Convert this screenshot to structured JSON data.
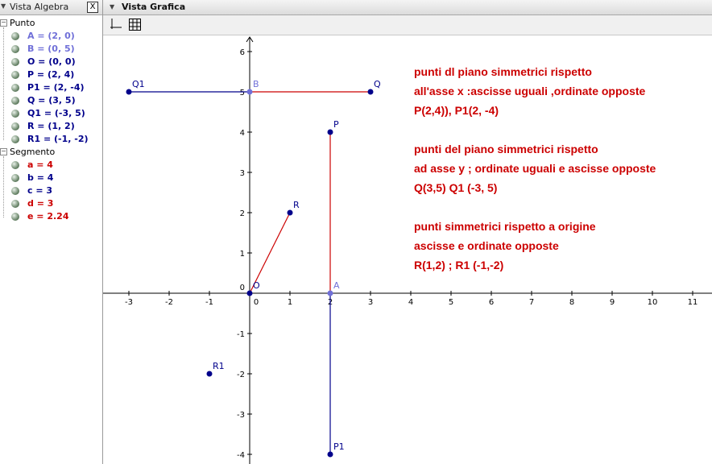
{
  "algebra": {
    "title": "Vista Algebra",
    "close_label": "X",
    "groups": [
      {
        "label": "Punto",
        "items": [
          {
            "text": "A = (2, 0)",
            "color": "#7070d8"
          },
          {
            "text": "B = (0, 5)",
            "color": "#7070d8"
          },
          {
            "text": "O = (0, 0)",
            "color": "#00008b"
          },
          {
            "text": "P = (2, 4)",
            "color": "#00008b"
          },
          {
            "text": "P1 = (2, -4)",
            "color": "#00008b"
          },
          {
            "text": "Q = (3, 5)",
            "color": "#00008b"
          },
          {
            "text": "Q1 = (-3, 5)",
            "color": "#00008b"
          },
          {
            "text": "R = (1, 2)",
            "color": "#00008b"
          },
          {
            "text": "R1 = (-1, -2)",
            "color": "#00008b"
          }
        ]
      },
      {
        "label": "Segmento",
        "items": [
          {
            "text": "a = 4",
            "color": "#cc0000"
          },
          {
            "text": "b = 4",
            "color": "#00008b"
          },
          {
            "text": "c = 3",
            "color": "#00008b"
          },
          {
            "text": "d = 3",
            "color": "#cc0000"
          },
          {
            "text": "e = 2.24",
            "color": "#cc0000"
          }
        ]
      }
    ]
  },
  "graphics": {
    "title": "Vista Grafica",
    "toolbar": [
      "axes-toggle-icon",
      "grid-toggle-icon"
    ],
    "axis_color": "#000000",
    "x_ticks": [
      -3,
      -2,
      -1,
      0,
      1,
      2,
      3,
      4,
      5,
      6,
      7,
      8,
      9,
      10,
      11
    ],
    "y_ticks": [
      -4,
      -3,
      -2,
      -1,
      0,
      1,
      2,
      3,
      4,
      5,
      6
    ],
    "points": [
      {
        "name": "A",
        "label": "A",
        "x": 2,
        "y": 0,
        "color": "#7070d8"
      },
      {
        "name": "B",
        "label": "B",
        "x": 0,
        "y": 5,
        "color": "#7070d8"
      },
      {
        "name": "O",
        "label": "O",
        "x": 0,
        "y": 0,
        "color": "#00008b"
      },
      {
        "name": "P",
        "label": "P",
        "x": 2,
        "y": 4,
        "color": "#00008b"
      },
      {
        "name": "P1",
        "label": "P1",
        "x": 2,
        "y": -4,
        "color": "#00008b"
      },
      {
        "name": "Q",
        "label": "Q",
        "x": 3,
        "y": 5,
        "color": "#00008b"
      },
      {
        "name": "Q1",
        "label": "Q1",
        "x": -3,
        "y": 5,
        "color": "#00008b"
      },
      {
        "name": "R",
        "label": "R",
        "x": 1,
        "y": 2,
        "color": "#00008b"
      },
      {
        "name": "R1",
        "label": "R1",
        "x": -1,
        "y": -2,
        "color": "#00008b"
      }
    ],
    "segments": [
      {
        "name": "a",
        "from": "A",
        "to": "P",
        "color": "#cc0000"
      },
      {
        "name": "b",
        "from": "A",
        "to": "P1",
        "color": "#00008b"
      },
      {
        "name": "c",
        "from": "B",
        "to": "Q1",
        "color": "#00008b"
      },
      {
        "name": "d",
        "from": "B",
        "to": "Q",
        "color": "#cc0000"
      },
      {
        "name": "e",
        "from": "O",
        "to": "R",
        "color": "#cc0000"
      }
    ],
    "text_color": "#cc0000",
    "text_lines": [
      "punti dl piano simmetrici rispetto",
      "all'asse x :ascisse uguali ,ordinate opposte",
      "P(2,4)), P1(2, -4)",
      "",
      "punti del piano simmetrici rispetto",
      "ad asse y ; ordinate uguali e ascisse opposte",
      "Q(3,5) Q1 (-3, 5)",
      "",
      "punti simmetrici rispetto a origine",
      "ascisse e ordinate opposte",
      "R(1,2) ; R1 (-1,-2)"
    ]
  }
}
